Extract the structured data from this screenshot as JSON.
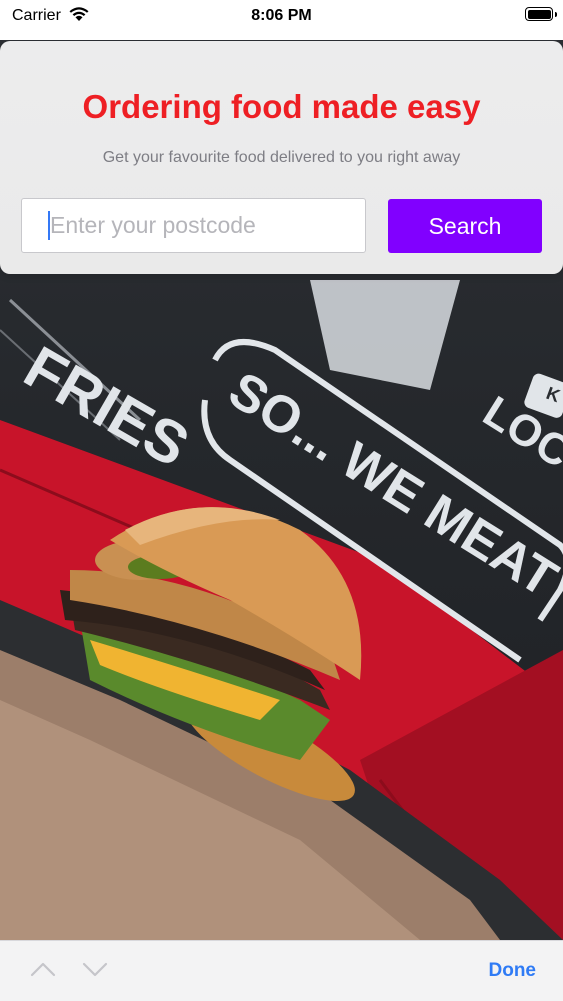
{
  "status_bar": {
    "carrier": "Carrier",
    "time": "8:06 PM",
    "icons": [
      "wifi-icon",
      "battery-icon"
    ]
  },
  "hero": {
    "title": "Ordering food made easy",
    "subtitle": "Get your favourite food delivered to you right away",
    "title_color": "#ee1f24"
  },
  "search": {
    "postcode_value": "",
    "postcode_placeholder": "Enter your postcode",
    "button_label": "Search",
    "button_color": "#8100ff"
  },
  "background_photo": {
    "wall_text": [
      "FRIES",
      "SO... WE MEAT",
      "LOC",
      "K"
    ]
  },
  "keyboard_toolbar": {
    "prev_icon": "chevron-up-icon",
    "next_icon": "chevron-down-icon",
    "done_label": "Done",
    "accent_color": "#2f7bf5"
  }
}
